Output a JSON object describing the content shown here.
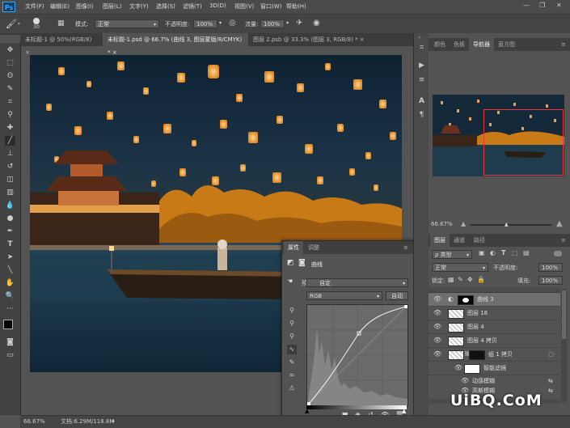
{
  "app": {
    "logo": "Ps"
  },
  "menu": [
    "文件(F)",
    "编辑(E)",
    "图像(I)",
    "图层(L)",
    "文字(Y)",
    "选择(S)",
    "滤镜(T)",
    "3D(D)",
    "视图(V)",
    "窗口(W)",
    "帮助(H)"
  ],
  "options": {
    "brush_size": "30",
    "mode_label": "模式:",
    "mode_value": "正常",
    "opacity_label": "不透明度:",
    "opacity_value": "100%",
    "flow_label": "流量:",
    "flow_value": "100%"
  },
  "tabs": [
    {
      "label": "未标题-1 @ 50%(RGB/8) ×",
      "active": false
    },
    {
      "label": "未标题-1.psd @ 66.7% (曲线 3, 图层蒙版/8/CMYK) * ×",
      "active": true
    },
    {
      "label": "图层 2.psb @ 33.3% (图层 3, RGB/8) * ×",
      "active": false
    }
  ],
  "status": {
    "zoom": "66.67%",
    "doc": "文档:6.29M/118.8M"
  },
  "top_panel": {
    "tabs": [
      "颜色",
      "色板",
      "导航器",
      "直方图"
    ],
    "active_tab": "导航器",
    "zoom": "66.67%"
  },
  "layers_panel": {
    "tabs": [
      "图层",
      "通道",
      "路径"
    ],
    "kind_label": "ρ 类型",
    "blend_mode": "正常",
    "opacity_label": "不透明度:",
    "opacity_value": "100%",
    "lock_label": "锁定:",
    "fill_label": "填充:",
    "fill_value": "100%",
    "rows": [
      {
        "name": "曲线 3",
        "selected": true
      },
      {
        "name": "图层 18"
      },
      {
        "name": "图层 4"
      },
      {
        "name": "图层 4 拷贝"
      },
      {
        "name": "组 1 拷贝"
      },
      {
        "name": "智能滤镜"
      },
      {
        "name": "动感模糊"
      },
      {
        "name": "高斯模糊"
      }
    ]
  },
  "properties": {
    "tabs": [
      "属性",
      "调整"
    ],
    "title": "曲线",
    "preset_label": "预设:",
    "preset_value": "自定",
    "channel": "RGB",
    "auto_button": "自动"
  },
  "watermark": "UiBQ.CoM"
}
